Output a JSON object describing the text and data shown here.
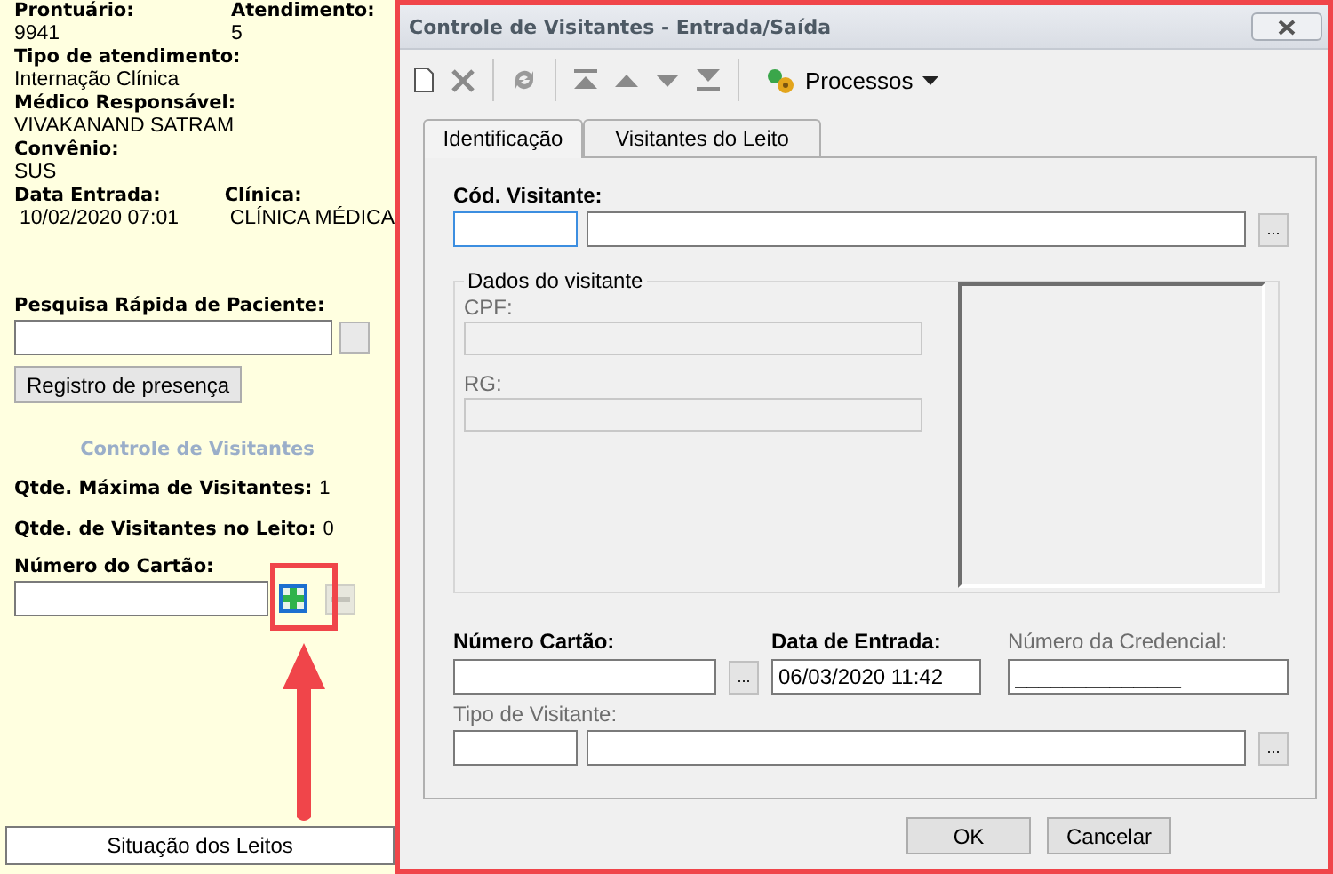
{
  "patient_panel": {
    "info_rows": [
      [
        {
          "label": "Prontuário:",
          "value": "9941"
        },
        {
          "label": "Atendimento:",
          "value": "5"
        }
      ],
      [
        {
          "label": "Tipo de atendimento:",
          "value": "Internação Clínica"
        }
      ],
      [
        {
          "label": "Médico Responsável:",
          "value": "VIVAKANAND SATRAM"
        }
      ],
      [
        {
          "label": "Convênio:",
          "value": "SUS"
        }
      ],
      [
        {
          "label": "Data Entrada:",
          "value": "10/02/2020 07:01"
        },
        {
          "label": "Clínica:",
          "value": "CLÍNICA MÉDICA"
        }
      ]
    ],
    "quick_search": {
      "label": "Pesquisa Rápida de Paciente:"
    },
    "register_button": "Registro de presença",
    "visitors_title": "Controle de Visitantes",
    "stats": [
      {
        "label": "Qtde. Máxima de Visitantes:",
        "value": "1"
      },
      {
        "label": "Qtde. de Visitantes no Leito:",
        "value": "0"
      }
    ],
    "card_number": {
      "label": "Número do Cartão:",
      "remove_disabled": true
    },
    "bottom_button": "Situação dos Leitos"
  },
  "dialog": {
    "title": "Controle de Visitantes - Entrada/Saída",
    "toolbar": {
      "menu": "Processos"
    },
    "tabs": [
      {
        "label": "Identificação",
        "selected": true
      },
      {
        "label": "Visitantes do Leito",
        "selected": false
      }
    ],
    "visitor_code": {
      "label": "Cód. Visitante:",
      "focused": true,
      "lookup": "..."
    },
    "visitor_data": {
      "legend": "Dados do visitante",
      "fields": [
        {
          "label": "CPF:",
          "disabled": true
        },
        {
          "label": "RG:",
          "disabled": true
        }
      ]
    },
    "card_number": {
      "label": "Número Cartão:",
      "lookup": "..."
    },
    "entry_date": {
      "label": "Data de Entrada:",
      "value": "06/03/2020 11:42"
    },
    "credential_number": {
      "label": "Número da Credencial:",
      "value": "______________"
    },
    "visitor_type": {
      "label": "Tipo de Visitante:",
      "lookup": "..."
    },
    "buttons": [
      "OK",
      "Cancelar"
    ]
  }
}
